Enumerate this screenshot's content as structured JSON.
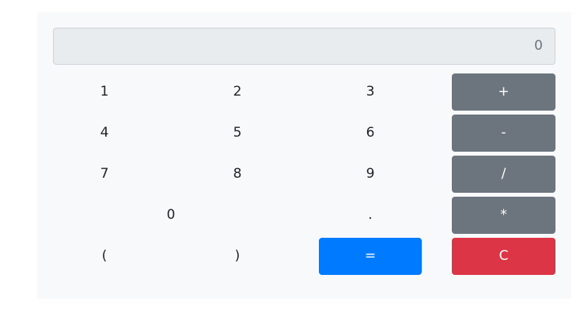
{
  "display": {
    "value": "0"
  },
  "keys": {
    "k1": "1",
    "k2": "2",
    "k3": "3",
    "k4": "4",
    "k5": "5",
    "k6": "6",
    "k7": "7",
    "k8": "8",
    "k9": "9",
    "k0": "0",
    "dot": ".",
    "lparen": "(",
    "rparen": ")",
    "plus": "+",
    "minus": "-",
    "divide": "/",
    "multiply": "*",
    "equals": "=",
    "clear": "C"
  },
  "colors": {
    "panel": "#f8f9fa",
    "display_bg": "#e9ecef",
    "operator": "#6c757d",
    "equals": "#007bff",
    "clear": "#dc3545"
  }
}
